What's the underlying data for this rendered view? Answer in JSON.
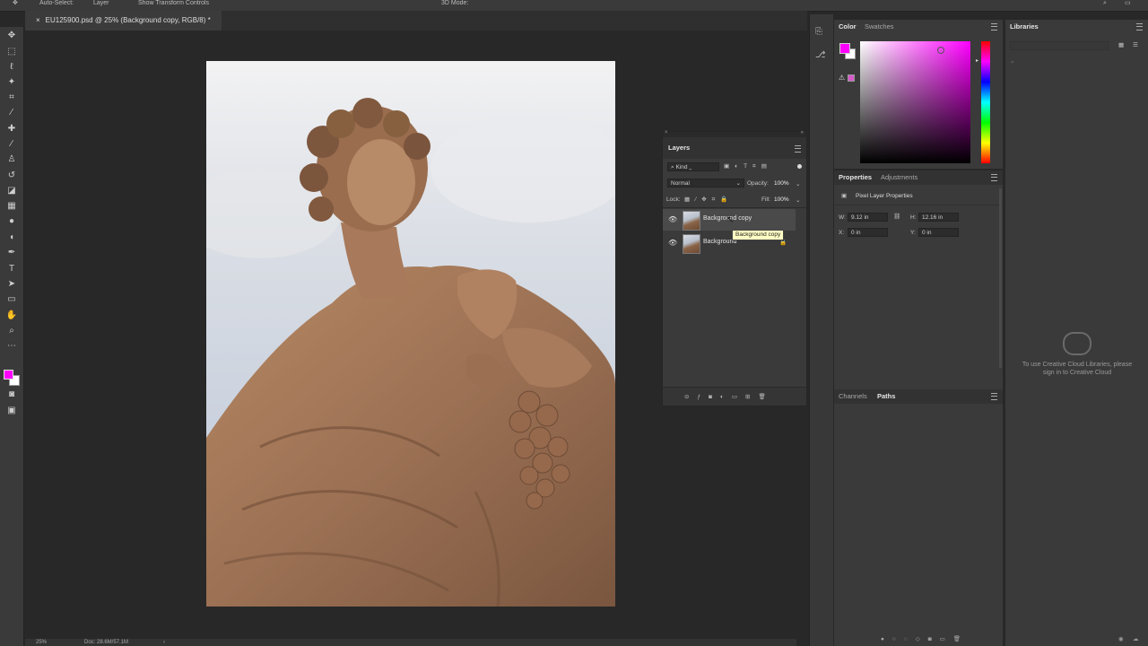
{
  "options_bar": {
    "auto_select_label": "Auto-Select:",
    "auto_select_value": "Layer",
    "show_transform_label": "Show Transform Controls",
    "mode_3d_label": "3D Mode:"
  },
  "document": {
    "tab_title": "EU125900.psd @ 25% (Background copy, RGB/8) *"
  },
  "status": {
    "zoom": "25%",
    "doc_size": "Doc: 28.6M/57.1M"
  },
  "color_panel": {
    "tabs": [
      "Color",
      "Swatches"
    ],
    "foreground": "#ff00ff",
    "background": "#ffffff"
  },
  "properties_panel": {
    "tabs": [
      "Properties",
      "Adjustments"
    ],
    "section_title": "Pixel Layer Properties",
    "w_label": "W:",
    "w_value": "9.12 in",
    "h_label": "H:",
    "h_value": "12.16 in",
    "x_label": "X:",
    "x_value": "0 in",
    "y_label": "Y:",
    "y_value": "0 in"
  },
  "channels_panel": {
    "tabs": [
      "Channels",
      "Paths"
    ]
  },
  "libraries_panel": {
    "title": "Libraries",
    "message": "To use Creative Cloud Libraries, please sign in to Creative Cloud"
  },
  "layers_panel": {
    "title": "Layers",
    "filter_kind": "Kind",
    "blend_mode": "Normal",
    "opacity_label": "Opacity:",
    "opacity_value": "100%",
    "lock_label": "Lock:",
    "fill_label": "Fill:",
    "fill_value": "100%",
    "layers": [
      {
        "name": "Background copy",
        "visible": true,
        "selected": true,
        "locked": false
      },
      {
        "name": "Background",
        "visible": true,
        "selected": false,
        "locked": true
      }
    ],
    "tooltip": "Background copy"
  }
}
